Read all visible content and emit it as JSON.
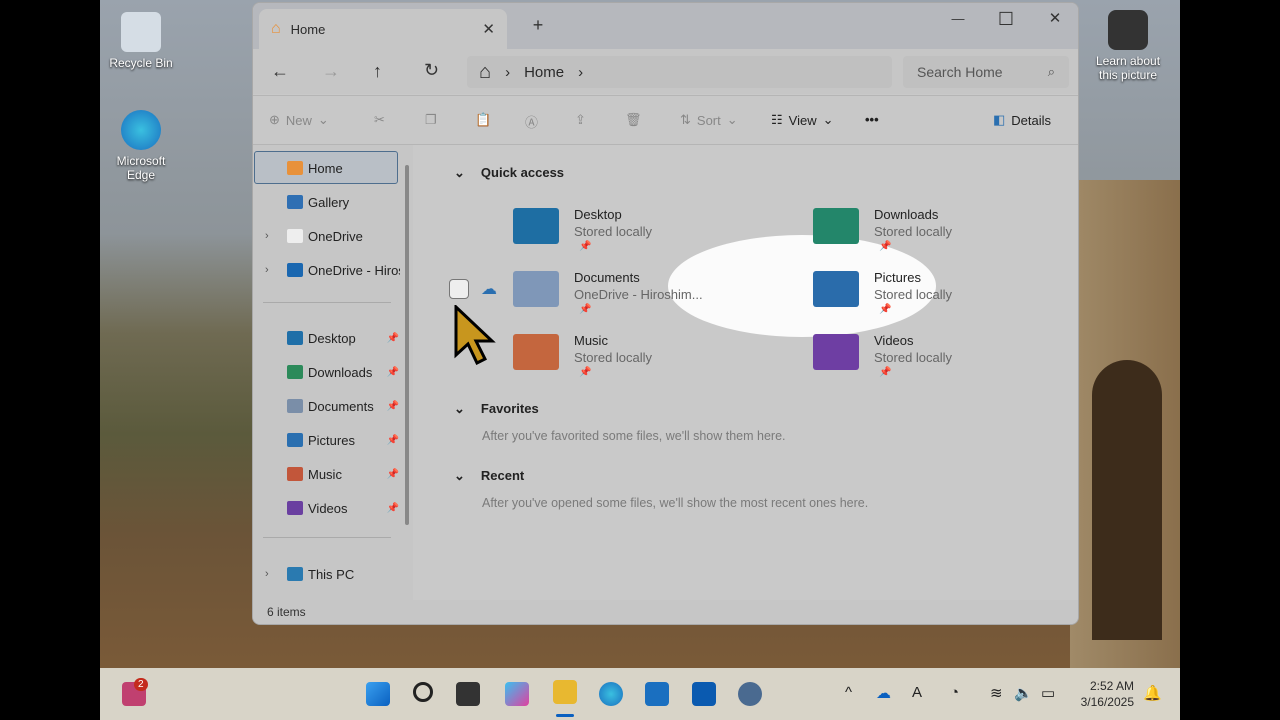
{
  "desktop": {
    "icons": [
      {
        "label": "Recycle Bin"
      },
      {
        "label": "Microsoft Edge"
      }
    ],
    "learn": "Learn about this picture"
  },
  "window": {
    "tab_title": "Home",
    "tab_close": "✕",
    "new_tab": "+",
    "controls": {
      "minimize": "—",
      "maximize": "☐",
      "close": "✕"
    },
    "nav": {
      "back": "←",
      "forward": "→",
      "up": "↑",
      "refresh": "↻"
    },
    "breadcrumb": {
      "home_icon": "⌂",
      "sep": "›",
      "current": "Home"
    },
    "search_placeholder": "Search Home",
    "toolbar": {
      "new": "New",
      "sort": "Sort",
      "view": "View",
      "more": "•••",
      "details": "Details"
    },
    "navpane": [
      {
        "label": "Home",
        "icon": "home",
        "color": "#e8913a"
      },
      {
        "label": "Gallery",
        "icon": "gallery",
        "color": "#2f6fb3"
      },
      {
        "label": "OneDrive",
        "icon": "document",
        "color": "#eeeeee",
        "expand": "›"
      },
      {
        "label": "OneDrive - Hiros",
        "icon": "cloud",
        "color": "#1a67b0",
        "expand": "›"
      },
      {
        "label": "Desktop",
        "icon": "desktop",
        "color": "#1f6fa8",
        "pin": "📌"
      },
      {
        "label": "Downloads",
        "icon": "download",
        "color": "#2c8a5a",
        "pin": "📌"
      },
      {
        "label": "Documents",
        "icon": "documents",
        "color": "#7a8ea8",
        "pin": "📌"
      },
      {
        "label": "Pictures",
        "icon": "pictures",
        "color": "#2a6fb0",
        "pin": "📌"
      },
      {
        "label": "Music",
        "icon": "music",
        "color": "#c2563a",
        "pin": "📌"
      },
      {
        "label": "Videos",
        "icon": "videos",
        "color": "#6a3fa0",
        "pin": "📌"
      },
      {
        "label": "This PC",
        "icon": "pc",
        "color": "#2a7ab0",
        "expand": "›"
      }
    ],
    "sections": {
      "quick_access": "Quick access",
      "favorites": "Favorites",
      "favorites_empty": "After you've favorited some files, we'll show them here.",
      "recent": "Recent",
      "recent_empty": "After you've opened some files, we'll show the most recent ones here.",
      "chevron": "⌄"
    },
    "quick_access": [
      {
        "name": "Desktop",
        "sub": "Stored locally",
        "color": "#1e6ea3"
      },
      {
        "name": "Downloads",
        "sub": "Stored locally",
        "color": "#23866a"
      },
      {
        "name": "Documents",
        "sub": "OneDrive - Hiroshim...",
        "color": "#7f97b8"
      },
      {
        "name": "Pictures",
        "sub": "Stored locally",
        "color": "#2a6cab"
      },
      {
        "name": "Music",
        "sub": "Stored locally",
        "color": "#c4663e"
      },
      {
        "name": "Videos",
        "sub": "Stored locally",
        "color": "#6e3ea3"
      }
    ],
    "pin": "📌",
    "status": "6 items"
  },
  "taskbar": {
    "badge": "2",
    "time": "2:52 AM",
    "date": "3/16/2025",
    "tray": {
      "chevron": "^",
      "ime": "A"
    }
  }
}
